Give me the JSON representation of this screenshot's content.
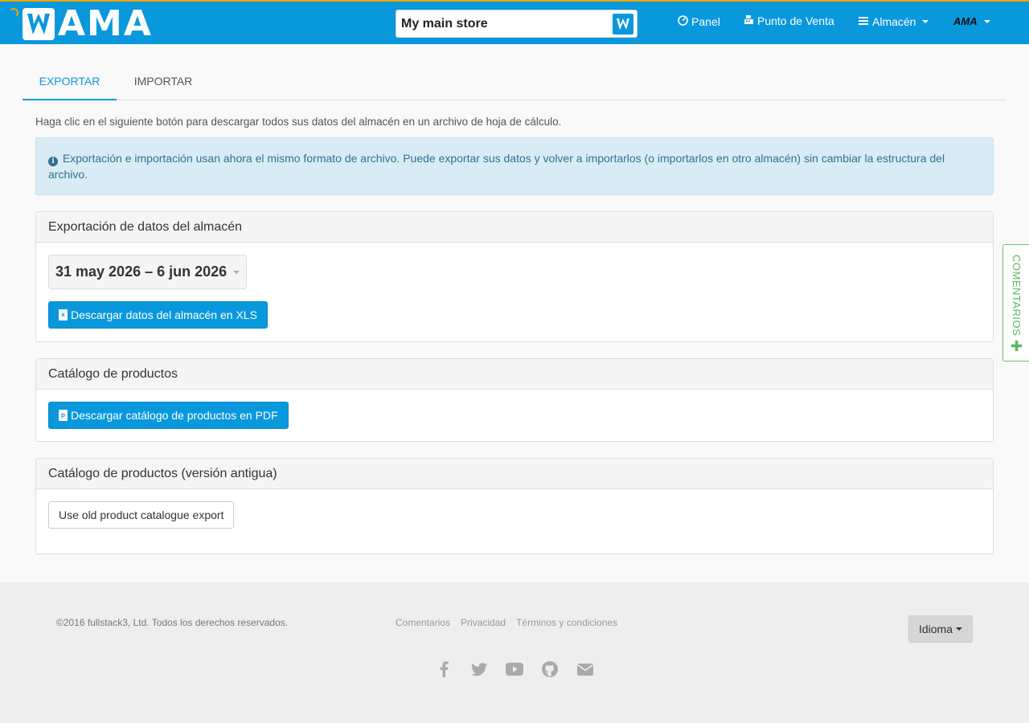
{
  "navbar": {
    "logo_text": "AMA",
    "store_name": "My main store",
    "items": [
      {
        "label": "Panel",
        "icon": "dashboard-icon"
      },
      {
        "label": "Punto de Venta",
        "icon": "cash-register-icon"
      },
      {
        "label": "Almacén",
        "icon": "bars-icon"
      }
    ],
    "user_logo": "AMA",
    "accent_color": "#0a98dd",
    "loader_color": "#f5a200"
  },
  "tabs": [
    {
      "label": "EXPORTAR",
      "active": true
    },
    {
      "label": "IMPORTAR",
      "active": false
    }
  ],
  "intro_text": "Haga clic en el siguiente botón para descargar todos sus datos del almacén en un archivo de hoja de cálculo.",
  "alert_text": "Exportación e importación usan ahora el mismo formato de archivo. Puede exportar sus datos y volver a importarlos (o importarlos en otro almacén) sin cambiar la estructura del archivo.",
  "panels": {
    "export": {
      "title": "Exportación de datos del almacén",
      "date_range": "31 may 2026 – 6 jun 2026",
      "button_label": "Descargar datos del almacén en XLS"
    },
    "catalog": {
      "title": "Catálogo de productos",
      "button_label": "Descargar catálogo de productos en PDF"
    },
    "old_catalog": {
      "title": "Catálogo de productos (versión antigua)",
      "button_label": "Use old product catalogue export"
    }
  },
  "feedback_label": "COMENTARIOS",
  "footer": {
    "copyright": "©2016 fullstack3, Ltd. Todos los derechos reservados.",
    "links": [
      "Comentarios",
      "Privacidad",
      "Términos y condiciones"
    ],
    "language_button": "Idioma",
    "social_icons": [
      "facebook-icon",
      "twitter-icon",
      "youtube-icon",
      "github-icon",
      "envelope-icon"
    ]
  }
}
